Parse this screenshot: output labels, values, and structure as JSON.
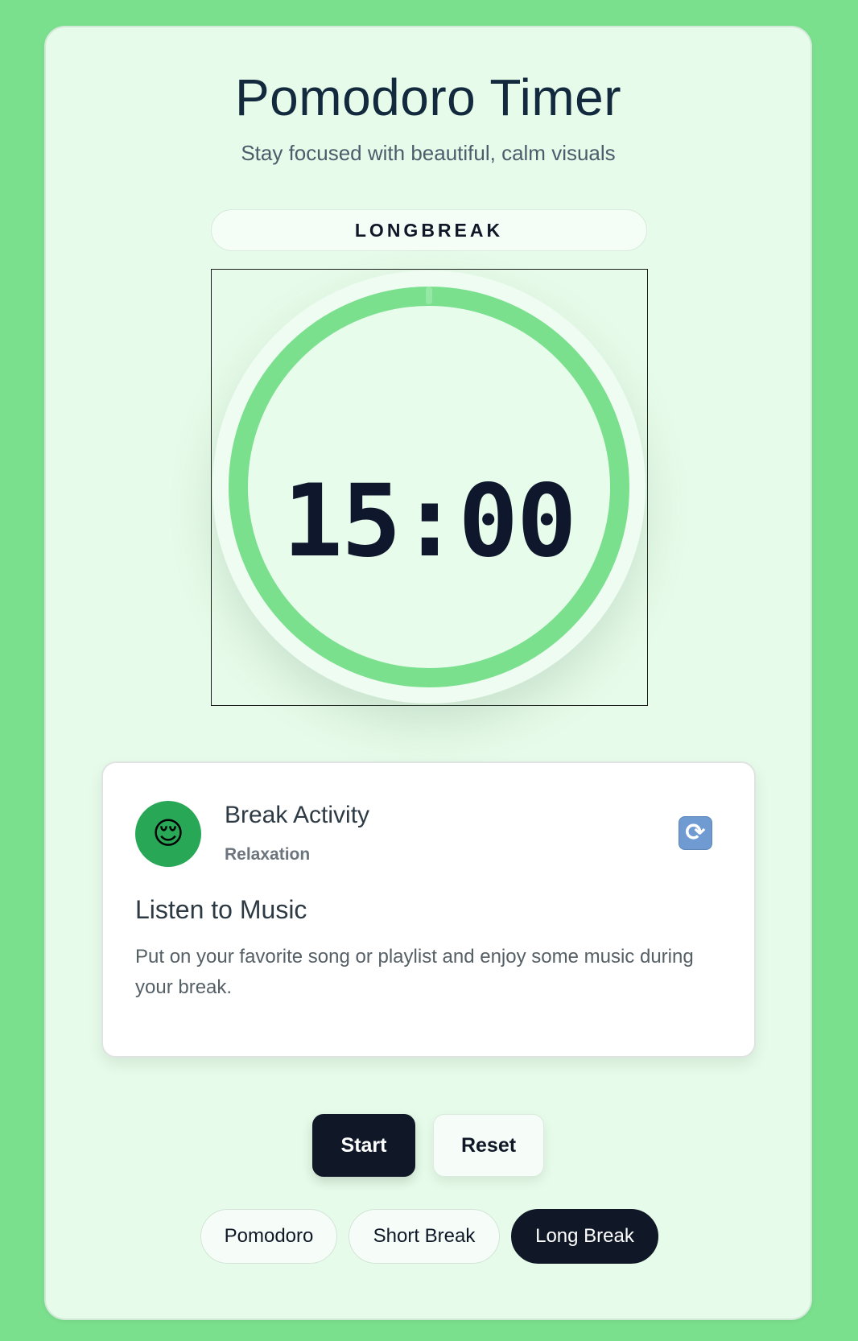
{
  "app": {
    "title": "Pomodoro Timer",
    "subtitle": "Stay focused with beautiful, calm visuals"
  },
  "timer": {
    "mode_label": "LONGBREAK",
    "time": "15:00",
    "progress": 1.0,
    "ring_color": "#7be08e"
  },
  "activity": {
    "heading": "Break Activity",
    "category": "Relaxation",
    "avatar_emoji": "😌",
    "refresh_icon": "refresh-icon",
    "title": "Listen to Music",
    "description": "Put on your favorite song or playlist and enjoy some music during your break."
  },
  "controls": {
    "start_label": "Start",
    "reset_label": "Reset"
  },
  "modes": [
    {
      "label": "Pomodoro",
      "active": false
    },
    {
      "label": "Short Break",
      "active": false
    },
    {
      "label": "Long Break",
      "active": true
    }
  ],
  "colors": {
    "background": "#7be08e",
    "card": "#e6fbe9",
    "dark": "#101828",
    "accent_green": "#28a857"
  }
}
